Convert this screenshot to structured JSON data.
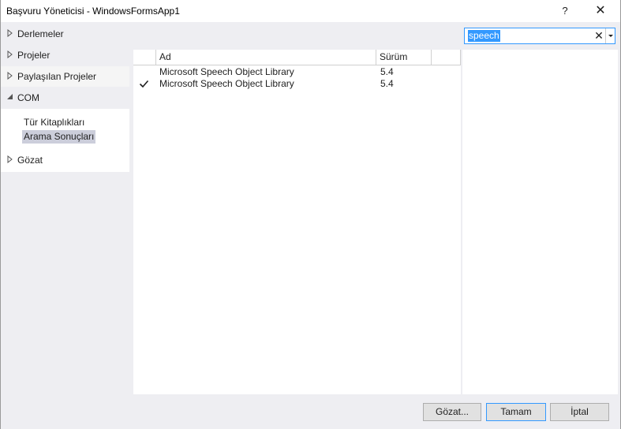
{
  "window": {
    "title": "Başvuru Yöneticisi - WindowsFormsApp1",
    "help_label": "?",
    "close_label": "✕"
  },
  "sidebar": {
    "items": [
      {
        "label": "Derlemeler",
        "expanded": false
      },
      {
        "label": "Projeler",
        "expanded": false
      },
      {
        "label": "Paylaşılan Projeler",
        "expanded": false
      },
      {
        "label": "COM",
        "expanded": true
      },
      {
        "label": "Gözat",
        "expanded": false
      }
    ],
    "com_children": [
      {
        "label": "Tür Kitaplıkları",
        "selected": false
      },
      {
        "label": "Arama Sonuçları",
        "selected": true
      }
    ]
  },
  "search": {
    "value": "speech",
    "clear_label": "✕"
  },
  "table": {
    "columns": [
      "Ad",
      "Sürüm"
    ],
    "rows": [
      {
        "checked": false,
        "name": "Microsoft Speech Object Library",
        "version": "5.4"
      },
      {
        "checked": true,
        "name": "Microsoft Speech Object Library",
        "version": "5.4"
      }
    ]
  },
  "footer": {
    "browse_label": "Gözat...",
    "ok_label": "Tamam",
    "cancel_label": "İptal"
  },
  "colors": {
    "accent": "#3399ff",
    "selection": "#cccedb",
    "background": "#eeeef2"
  }
}
